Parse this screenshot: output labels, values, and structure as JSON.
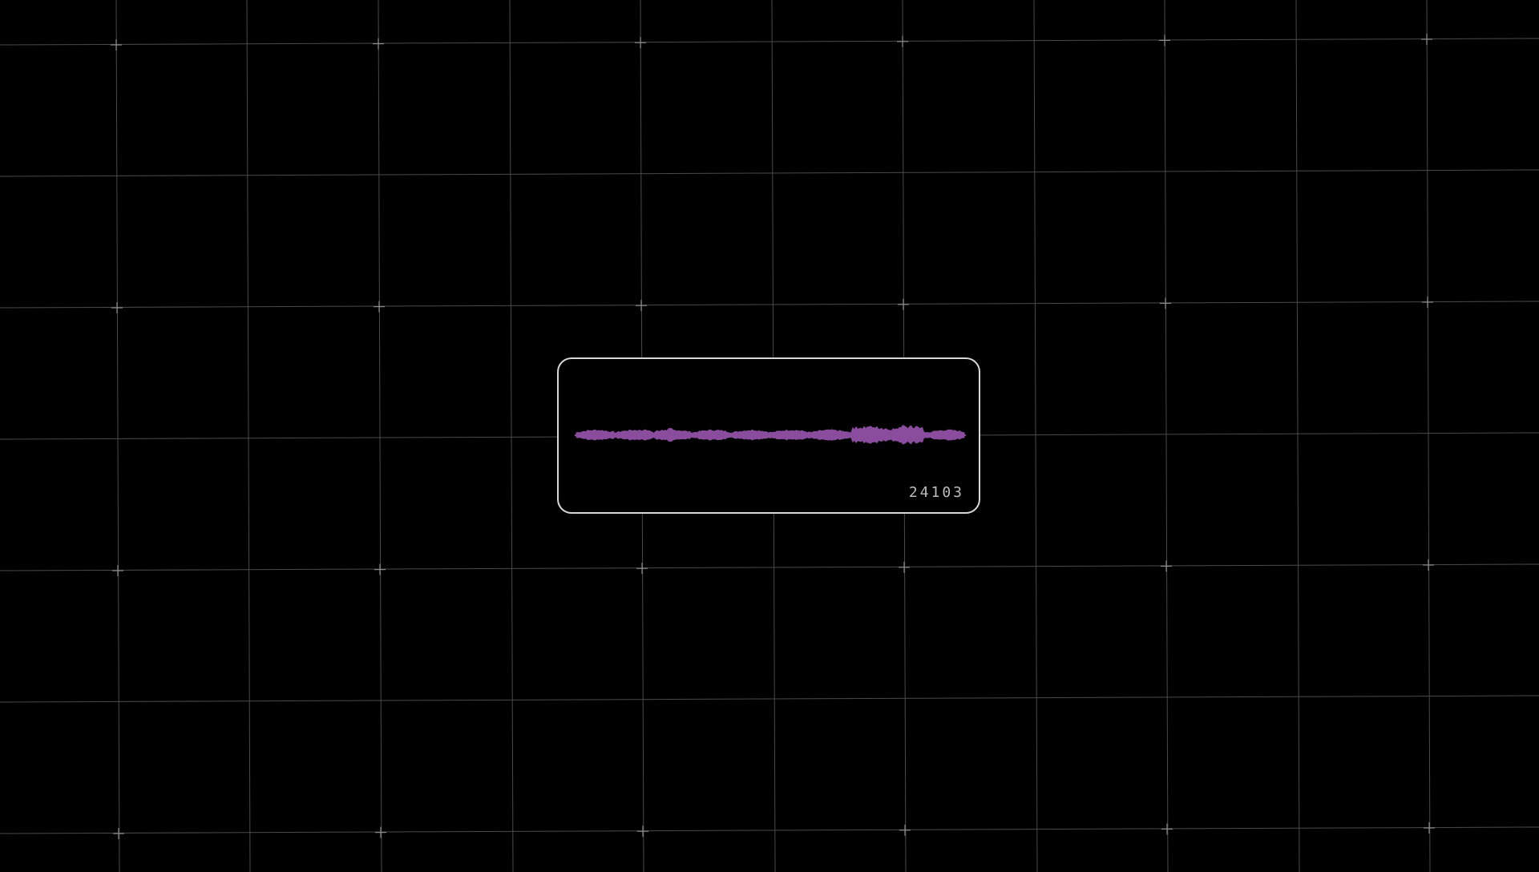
{
  "colors": {
    "background": "#000000",
    "grid_line": "#4a4a4a",
    "grid_cross": "#8a8a8a",
    "panel_border": "#d8d8d8",
    "waveform": "#8a4d9e",
    "counter_text": "#bdbdbd"
  },
  "icons": {
    "grid_marker": "plus-cross-icon"
  },
  "audio_panel": {
    "counter": "24103"
  }
}
